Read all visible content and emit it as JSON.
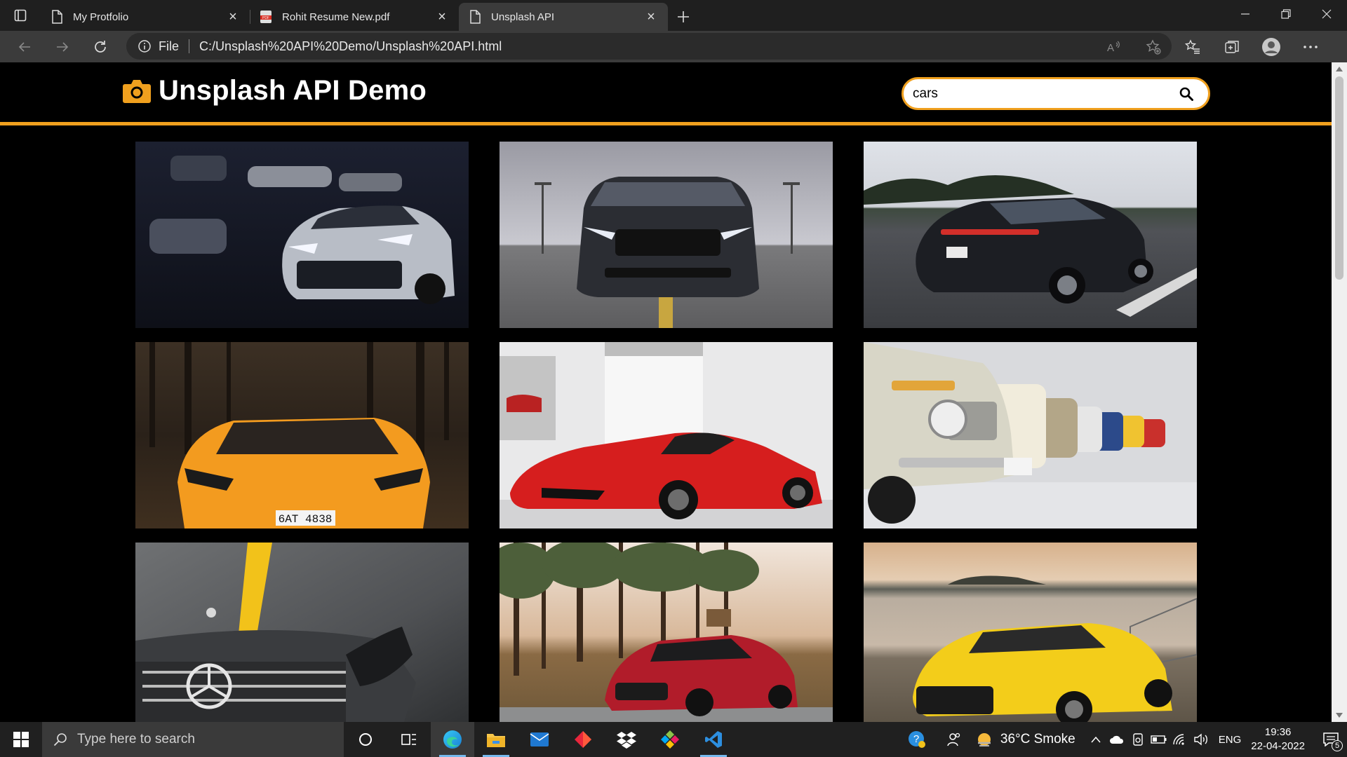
{
  "browser": {
    "tabs": [
      {
        "title": "My Protfolio",
        "icon": "page-icon",
        "active": false
      },
      {
        "title": "Rohit Resume New.pdf",
        "icon": "pdf-icon",
        "active": false
      },
      {
        "title": "Unsplash API",
        "icon": "page-icon",
        "active": true
      }
    ],
    "address": {
      "info_label": "File",
      "url": "C:/Unsplash%20API%20Demo/Unsplash%20API.html"
    }
  },
  "page": {
    "title": "Unsplash API Demo",
    "brand_icon": "camera-icon",
    "accent_color": "#f0a01e",
    "search": {
      "value": "cars",
      "placeholder": ""
    },
    "photos": [
      {
        "subject": "silver-sports-car-in-dark-garage"
      },
      {
        "subject": "black-mustang-front-on-parking-deck"
      },
      {
        "subject": "black-porsche-panamera-driving"
      },
      {
        "subject": "orange-lamborghini-in-forest"
      },
      {
        "subject": "red-ferrari-in-showroom"
      },
      {
        "subject": "row-of-classic-bmw-cars"
      },
      {
        "subject": "grey-mercedes-with-yellow-stripe"
      },
      {
        "subject": "red-mercedes-amg-gt-by-trees"
      },
      {
        "subject": "yellow-audi-r8-by-lake"
      }
    ],
    "plates": {
      "orange_car": "6AT 4838"
    }
  },
  "taskbar": {
    "search_placeholder": "Type here to search",
    "weather": "36°C  Smoke",
    "language": "ENG",
    "time": "19:36",
    "date": "22-04-2022",
    "notification_count": "5"
  }
}
